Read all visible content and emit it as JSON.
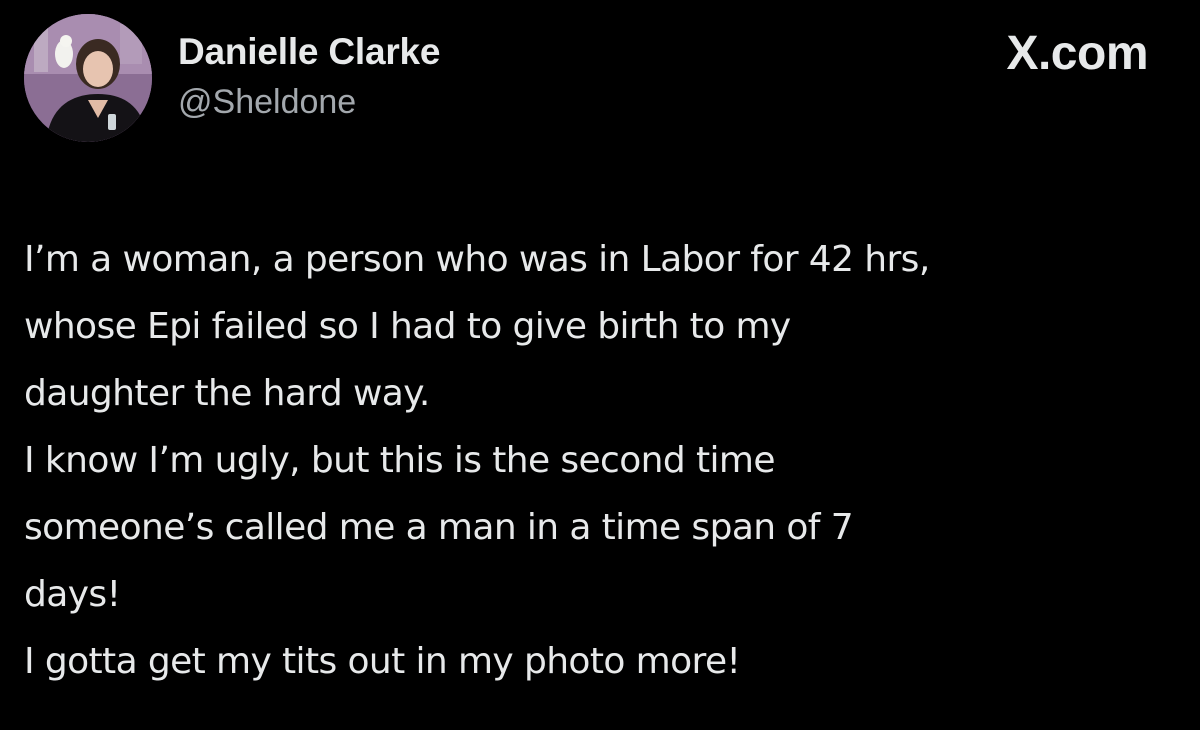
{
  "author": {
    "display_name": "Danielle Clarke",
    "handle": "@Sheldone",
    "avatar_icon": "profile-photo"
  },
  "brand": {
    "site_label": "X.com"
  },
  "tweet": {
    "lines": [
      "I’m a woman, a person who was in Labor for 42 hrs,",
      "whose Epi failed so I had to give birth to my",
      "daughter the hard way.",
      "I know I’m ugly, but this is the second time",
      "someone’s called me a man in a time span of 7",
      "days!",
      "I gotta get my tits out in my photo more!"
    ]
  },
  "colors": {
    "background": "#000000",
    "primary_text": "#e7e9ea",
    "secondary_text": "#a3a8ad"
  }
}
